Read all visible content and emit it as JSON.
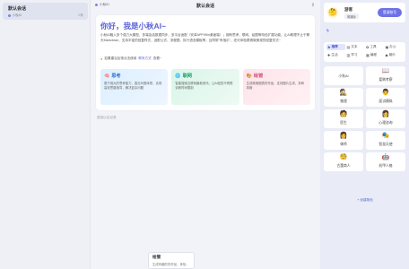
{
  "sidebar": {
    "session_title": "默认会话",
    "session_model": "小秋AI",
    "session_count": "0条"
  },
  "header": {
    "model_name": "小秋AI",
    "title": "默认会话",
    "icon": "share-icon"
  },
  "welcome": {
    "title": "你好，我是小秋AI~",
    "description": "小秋AI融入多个强力大模型，多端会话数据同步，多平台适配（安卓APP/Win桌面端）；拥有思考、联网、绘图等特色扩展功能，让AI助理不止于聊天Markdown，支持丰富的回复样式，适配公式、流程图、执行语言模板等，且附带\"有指示\"，还可体验更精致美观的回复形式~",
    "tip_prefix": "如果建议反馈点击使用",
    "tip_link": "联系方式",
    "tip_suffix": "查看~",
    "features": [
      {
        "icon": "brain-icon",
        "title": "思考",
        "desc": "基于强大的思考能力，直击问题本质，实现高效思路指导，解决复杂问题"
      },
      {
        "icon": "globe-icon",
        "title": "联网",
        "desc": "智能搜索互联网最新资讯，让AI回答不再受训练时间限制"
      },
      {
        "icon": "palette-icon",
        "title": "绘管",
        "desc": "生成精美图表的作品，支持图片生成，多种风格"
      }
    ],
    "history_link": "查找以往记录"
  },
  "float_card": {
    "title": "绘管",
    "desc": "生成有趣的的作品，体验…"
  },
  "right_panel": {
    "user_name": "游客",
    "user_badge": "普通版",
    "login_label": "登录账号",
    "bolt_label": "AI",
    "categories": [
      {
        "icon": "star-icon",
        "label": "推荐",
        "active": true
      },
      {
        "icon": "doc-icon",
        "label": "文本"
      },
      {
        "icon": "tool-icon",
        "label": "工具"
      },
      {
        "icon": "office-icon",
        "label": "办公"
      },
      {
        "icon": "life-icon",
        "label": "生活"
      },
      {
        "icon": "study-icon",
        "label": "学习"
      },
      {
        "icon": "edit-icon",
        "label": "编程"
      },
      {
        "icon": "more-icon",
        "label": "娱乐"
      }
    ],
    "roles": [
      {
        "icon": "",
        "name": "小秋AI"
      },
      {
        "icon": "book-icon",
        "name": "爱刷考察"
      },
      {
        "icon": "detective-icon",
        "name": "推理"
      },
      {
        "icon": "interviewer-icon",
        "name": "面试模拟"
      },
      {
        "icon": "traveler-icon",
        "name": "医生"
      },
      {
        "icon": "counselor-icon",
        "name": "心理咨询"
      },
      {
        "icon": "lawyer-icon",
        "name": "律师"
      },
      {
        "icon": "mind-icon",
        "name": "智慧天使"
      },
      {
        "icon": "hero-icon",
        "name": "古董商人"
      },
      {
        "icon": "robot-icon",
        "name": "机甲人格"
      }
    ],
    "add_role_label": "+ 创建角色"
  }
}
